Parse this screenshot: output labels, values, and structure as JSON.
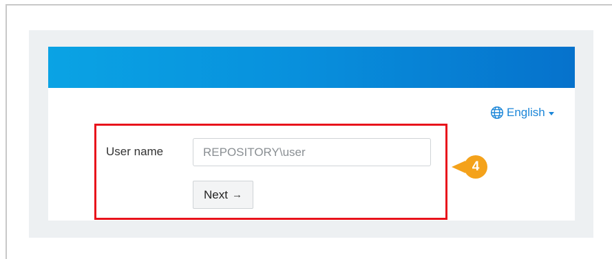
{
  "language": {
    "label": "English",
    "icon": "globe-icon"
  },
  "form": {
    "username_label": "User name",
    "username_value": "",
    "username_placeholder": "REPOSITORY\\user",
    "next_label": "Next",
    "next_icon": "arrow-right-icon"
  },
  "annotation": {
    "step_number": "4"
  },
  "colors": {
    "header_start": "#0aa3e4",
    "header_end": "#0672cc",
    "link": "#1b86d8",
    "highlight_border": "#e8121b",
    "step_badge": "#f4a21b"
  }
}
